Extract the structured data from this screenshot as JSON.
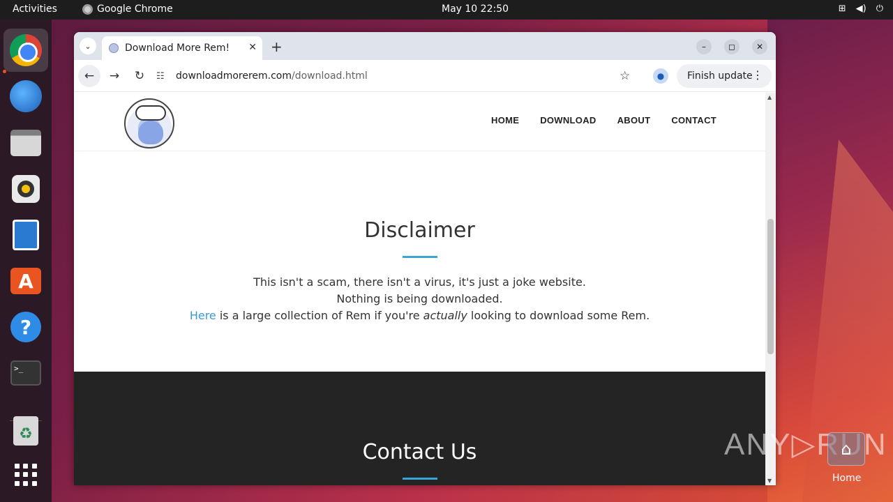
{
  "topbar": {
    "activities": "Activities",
    "app_name": "Google Chrome",
    "datetime": "May 10  22:50",
    "tray": [
      "network-icon",
      "volume-icon",
      "power-icon"
    ]
  },
  "dock": {
    "items": [
      "chrome-icon",
      "thunderbird-icon",
      "files-icon",
      "rhythmbox-icon",
      "writer-icon",
      "app-center-icon",
      "help-icon",
      "terminal-icon",
      "trash-icon",
      "show-apps-icon"
    ]
  },
  "browser": {
    "tab_title": "Download More Rem!",
    "tab_close": "✕",
    "new_tab": "+",
    "url_domain": "downloadmorerem.com",
    "url_path": "/download.html",
    "update_label": "Finish update",
    "min": "–",
    "max": "◻",
    "close": "✕"
  },
  "site": {
    "nav": [
      "HOME",
      "DOWNLOAD",
      "ABOUT",
      "CONTACT"
    ],
    "disclaimer_title": "Disclaimer",
    "line1": "This isn't a scam, there isn't a virus, it's just a joke website.",
    "line2": "Nothing is being downloaded.",
    "line3_link": "Here",
    "line3_mid": " is a large collection of Rem if you're ",
    "line3_em": "actually",
    "line3_end": " looking to download some Rem.",
    "contact_title": "Contact Us"
  },
  "watermark": "ANY▷RUN",
  "desktop": {
    "home_label": "Home"
  },
  "colors": {
    "accent_underline": "#3aa6d8",
    "link": "#3a9ad9",
    "footer_bg": "#242424",
    "ubuntu_orange": "#e95420"
  }
}
